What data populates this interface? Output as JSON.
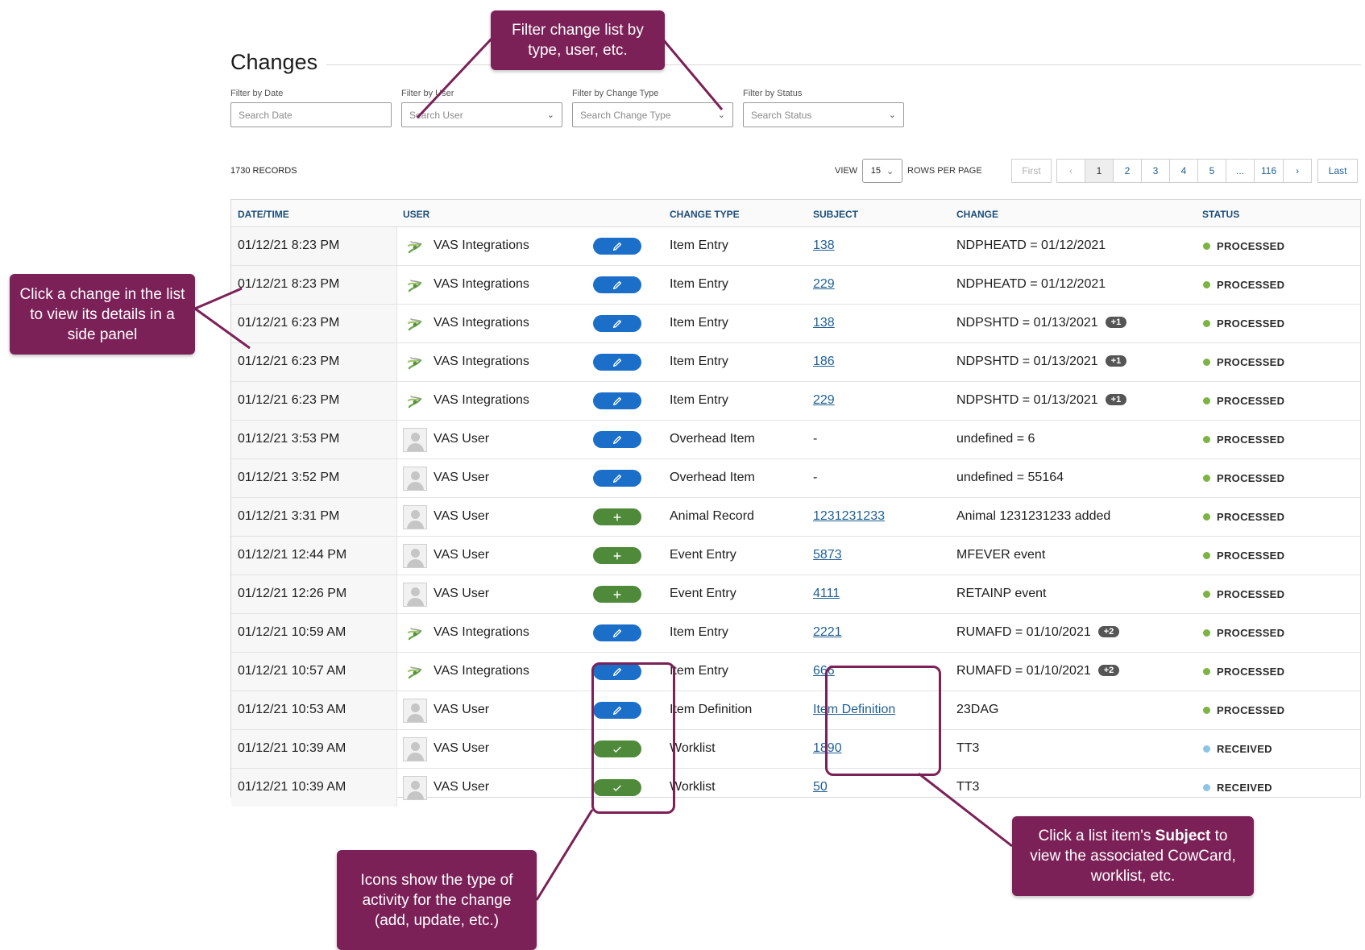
{
  "page": {
    "title": "Changes"
  },
  "filters": [
    {
      "label": "Filter by Date",
      "placeholder": "Search Date",
      "dropdown": false
    },
    {
      "label": "Filter by User",
      "placeholder": "Search User",
      "dropdown": true
    },
    {
      "label": "Filter by Change Type",
      "placeholder": "Search Change Type",
      "dropdown": true
    },
    {
      "label": "Filter by Status",
      "placeholder": "Search Status",
      "dropdown": true
    }
  ],
  "records": {
    "count_label": "1730 RECORDS"
  },
  "pagination": {
    "view_label": "VIEW",
    "rows_per_page": "15",
    "rows_label": "ROWS PER PAGE",
    "first": "First",
    "prev": "‹",
    "pages": [
      "1",
      "2",
      "3",
      "4",
      "5",
      "...",
      "116"
    ],
    "active_page": "1",
    "next": "›",
    "last": "Last"
  },
  "table": {
    "headers": {
      "datetime": "DATE/TIME",
      "user": "USER",
      "change_type": "CHANGE TYPE",
      "subject": "SUBJECT",
      "change": "CHANGE",
      "status": "STATUS"
    },
    "rows": [
      {
        "datetime": "01/12/21 8:23 PM",
        "user": "VAS Integrations",
        "user_kind": "integration",
        "activity": "edit",
        "change_type": "Item Entry",
        "subject": "138",
        "subject_link": true,
        "change": "NDPHEATD = 01/12/2021",
        "badge": "",
        "status": "PROCESSED"
      },
      {
        "datetime": "01/12/21 8:23 PM",
        "user": "VAS Integrations",
        "user_kind": "integration",
        "activity": "edit",
        "change_type": "Item Entry",
        "subject": "229",
        "subject_link": true,
        "change": "NDPHEATD = 01/12/2021",
        "badge": "",
        "status": "PROCESSED"
      },
      {
        "datetime": "01/12/21 6:23 PM",
        "user": "VAS Integrations",
        "user_kind": "integration",
        "activity": "edit",
        "change_type": "Item Entry",
        "subject": "138",
        "subject_link": true,
        "change": "NDPSHTD = 01/13/2021",
        "badge": "+1",
        "status": "PROCESSED"
      },
      {
        "datetime": "01/12/21 6:23 PM",
        "user": "VAS Integrations",
        "user_kind": "integration",
        "activity": "edit",
        "change_type": "Item Entry",
        "subject": "186",
        "subject_link": true,
        "change": "NDPSHTD = 01/13/2021",
        "badge": "+1",
        "status": "PROCESSED"
      },
      {
        "datetime": "01/12/21 6:23 PM",
        "user": "VAS Integrations",
        "user_kind": "integration",
        "activity": "edit",
        "change_type": "Item Entry",
        "subject": "229",
        "subject_link": true,
        "change": "NDPSHTD = 01/13/2021",
        "badge": "+1",
        "status": "PROCESSED"
      },
      {
        "datetime": "01/12/21 3:53 PM",
        "user": "VAS User",
        "user_kind": "person",
        "activity": "edit",
        "change_type": "Overhead Item",
        "subject": "-",
        "subject_link": false,
        "change": "undefined = 6",
        "badge": "",
        "status": "PROCESSED"
      },
      {
        "datetime": "01/12/21 3:52 PM",
        "user": "VAS User",
        "user_kind": "person",
        "activity": "edit",
        "change_type": "Overhead Item",
        "subject": "-",
        "subject_link": false,
        "change": "undefined = 55164",
        "badge": "",
        "status": "PROCESSED"
      },
      {
        "datetime": "01/12/21 3:31 PM",
        "user": "VAS User",
        "user_kind": "person",
        "activity": "add",
        "change_type": "Animal Record",
        "subject": "1231231233",
        "subject_link": true,
        "change": "Animal 1231231233 added",
        "badge": "",
        "status": "PROCESSED"
      },
      {
        "datetime": "01/12/21 12:44 PM",
        "user": "VAS User",
        "user_kind": "person",
        "activity": "add",
        "change_type": "Event Entry",
        "subject": "5873",
        "subject_link": true,
        "change": "MFEVER event",
        "badge": "",
        "status": "PROCESSED"
      },
      {
        "datetime": "01/12/21 12:26 PM",
        "user": "VAS User",
        "user_kind": "person",
        "activity": "add",
        "change_type": "Event Entry",
        "subject": "4111",
        "subject_link": true,
        "change": "RETAINP event",
        "badge": "",
        "status": "PROCESSED"
      },
      {
        "datetime": "01/12/21 10:59 AM",
        "user": "VAS Integrations",
        "user_kind": "integration",
        "activity": "edit",
        "change_type": "Item Entry",
        "subject": "2221",
        "subject_link": true,
        "change": "RUMAFD = 01/10/2021",
        "badge": "+2",
        "status": "PROCESSED"
      },
      {
        "datetime": "01/12/21 10:57 AM",
        "user": "VAS Integrations",
        "user_kind": "integration",
        "activity": "edit",
        "change_type": "Item Entry",
        "subject": "666",
        "subject_link": true,
        "change": "RUMAFD = 01/10/2021",
        "badge": "+2",
        "status": "PROCESSED"
      },
      {
        "datetime": "01/12/21 10:53 AM",
        "user": "VAS User",
        "user_kind": "person",
        "activity": "edit",
        "change_type": "Item Definition",
        "subject": "Item Definition",
        "subject_link": true,
        "change": "23DAG",
        "badge": "",
        "status": "PROCESSED"
      },
      {
        "datetime": "01/12/21 10:39 AM",
        "user": "VAS User",
        "user_kind": "person",
        "activity": "check",
        "change_type": "Worklist",
        "subject": "1890",
        "subject_link": true,
        "change": "TT3",
        "badge": "",
        "status": "RECEIVED"
      },
      {
        "datetime": "01/12/21 10:39 AM",
        "user": "VAS User",
        "user_kind": "person",
        "activity": "check",
        "change_type": "Worklist",
        "subject": "50",
        "subject_link": true,
        "change": "TT3",
        "badge": "",
        "status": "RECEIVED"
      }
    ]
  },
  "status_colors": {
    "PROCESSED": "#7cb342",
    "RECEIVED": "#8cc4e6"
  },
  "activity_icons": {
    "edit": "pencil-icon",
    "add": "plus-icon",
    "check": "check-icon"
  },
  "callouts": {
    "filter": "Filter change list by type, user, etc.",
    "click_change": "Click a change in the list to view its details in a side panel",
    "icons": "Icons show the type of activity for the change (add, update, etc.)",
    "subject_prefix": "Click a list item's ",
    "subject_bold": "Subject",
    "subject_suffix": " to view the associated CowCard, worklist, etc."
  },
  "brand": {
    "callout_color": "#7b2158",
    "edit_pill": "#1c6fc9",
    "add_pill": "#4f8a3a"
  }
}
